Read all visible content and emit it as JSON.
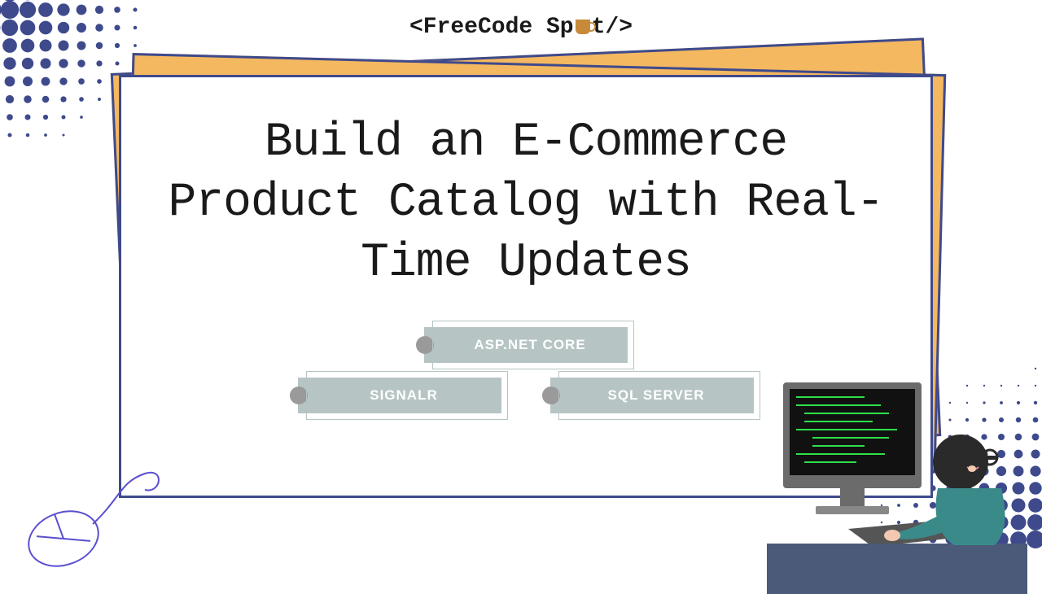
{
  "logo": {
    "open": "<FreeCode Sp",
    "close": "t/>"
  },
  "title": "Build an E-Commerce Product Catalog with Real-Time Updates",
  "tags": {
    "top": "ASP.NET CORE",
    "left": "SIGNALR",
    "right": "SQL SERVER"
  },
  "colors": {
    "navy": "#3e4a8c",
    "mustard": "#f4b860",
    "chip": "#b6c4c4"
  }
}
